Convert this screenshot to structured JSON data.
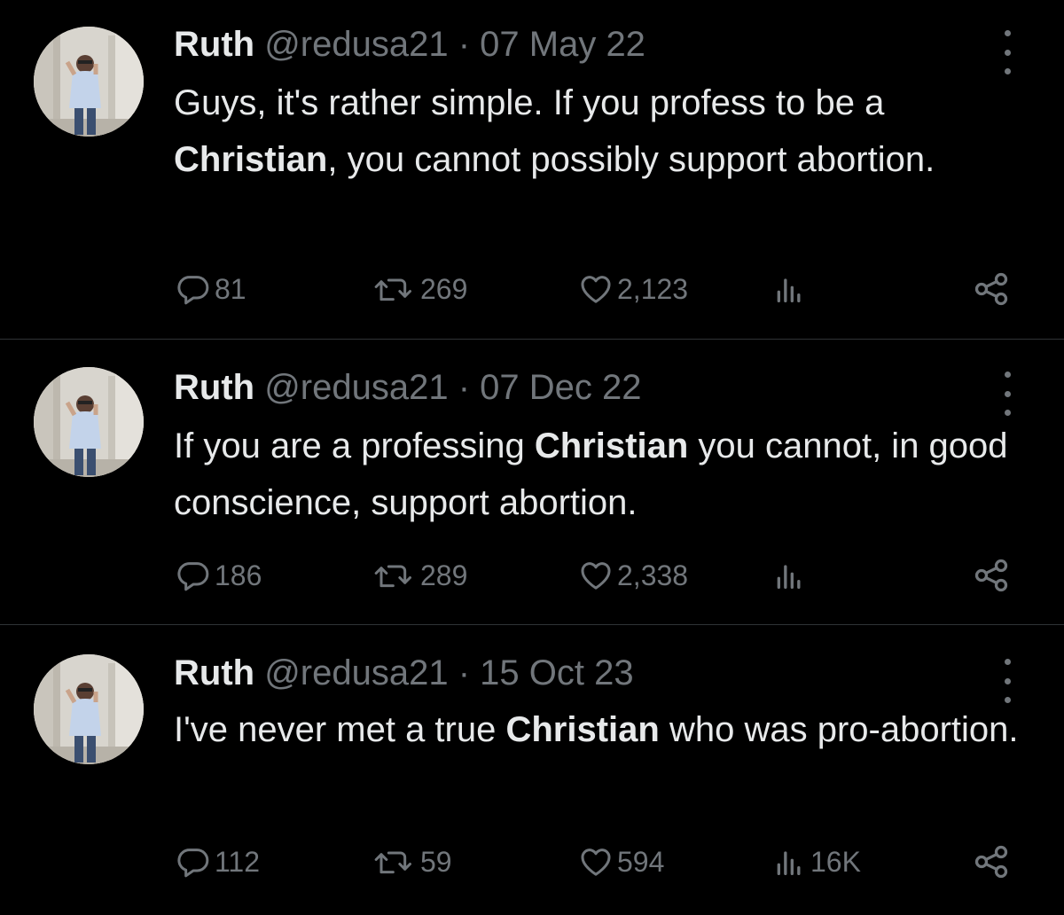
{
  "tweets": [
    {
      "name": "Ruth",
      "meta": "@redusa21 · 07 May 22",
      "text_before": "Guys, it's rather simple. If you profess to be a ",
      "text_bold": "Christian",
      "text_after": ", you cannot possibly support abortion.",
      "replies": "81",
      "retweets": "269",
      "likes": "2,123",
      "views": ""
    },
    {
      "name": "Ruth",
      "meta": "@redusa21 · 07 Dec 22",
      "text_before": "If you are a professing ",
      "text_bold": "Christian",
      "text_after": " you cannot, in good conscience, support abortion.",
      "replies": "186",
      "retweets": "289",
      "likes": "2,338",
      "views": ""
    },
    {
      "name": "Ruth",
      "meta": "@redusa21 · 15 Oct 23",
      "text_before": "I've never met a true ",
      "text_bold": "Christian",
      "text_after": " who was pro-abortion.",
      "replies": "112",
      "retweets": "59",
      "likes": "594",
      "views": "16K"
    }
  ],
  "icons": {
    "reply": "reply-icon",
    "retweet": "retweet-icon",
    "like": "heart-icon",
    "views": "views-icon",
    "share": "share-icon",
    "more": "more-icon"
  },
  "colors": {
    "background": "#000000",
    "text": "#e7e9ea",
    "muted": "#71767b",
    "divider": "#2f3336"
  }
}
